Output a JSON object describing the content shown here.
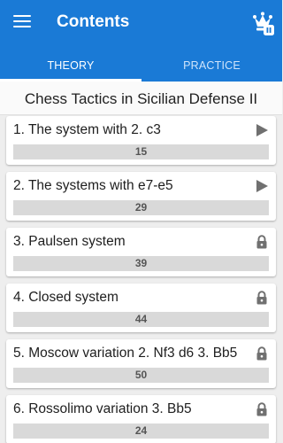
{
  "header": {
    "title": "Contents",
    "menu_icon": "hamburger-menu-icon",
    "logo_icon": "crown-icon"
  },
  "tabs": [
    {
      "label": "THEORY",
      "active": true
    },
    {
      "label": "PRACTICE",
      "active": false
    }
  ],
  "course_title": "Chess Tactics in Sicilian Defense II",
  "colors": {
    "primary": "#1a7ad6",
    "bar": "#d9d9d9",
    "icon": "#707070"
  },
  "chapters": [
    {
      "title": "1. The system with 2. c3",
      "count": "15",
      "icon": "play-icon"
    },
    {
      "title": "2. The systems with e7-e5",
      "count": "29",
      "icon": "play-icon"
    },
    {
      "title": "3. Paulsen system",
      "count": "39",
      "icon": "lock-icon"
    },
    {
      "title": "4. Closed system",
      "count": "44",
      "icon": "lock-icon"
    },
    {
      "title": "5. Moscow variation 2. Nf3 d6 3. Bb5",
      "count": "50",
      "icon": "lock-icon"
    },
    {
      "title": "6. Rossolimo variation 3. Bb5",
      "count": "24",
      "icon": "lock-icon"
    }
  ]
}
